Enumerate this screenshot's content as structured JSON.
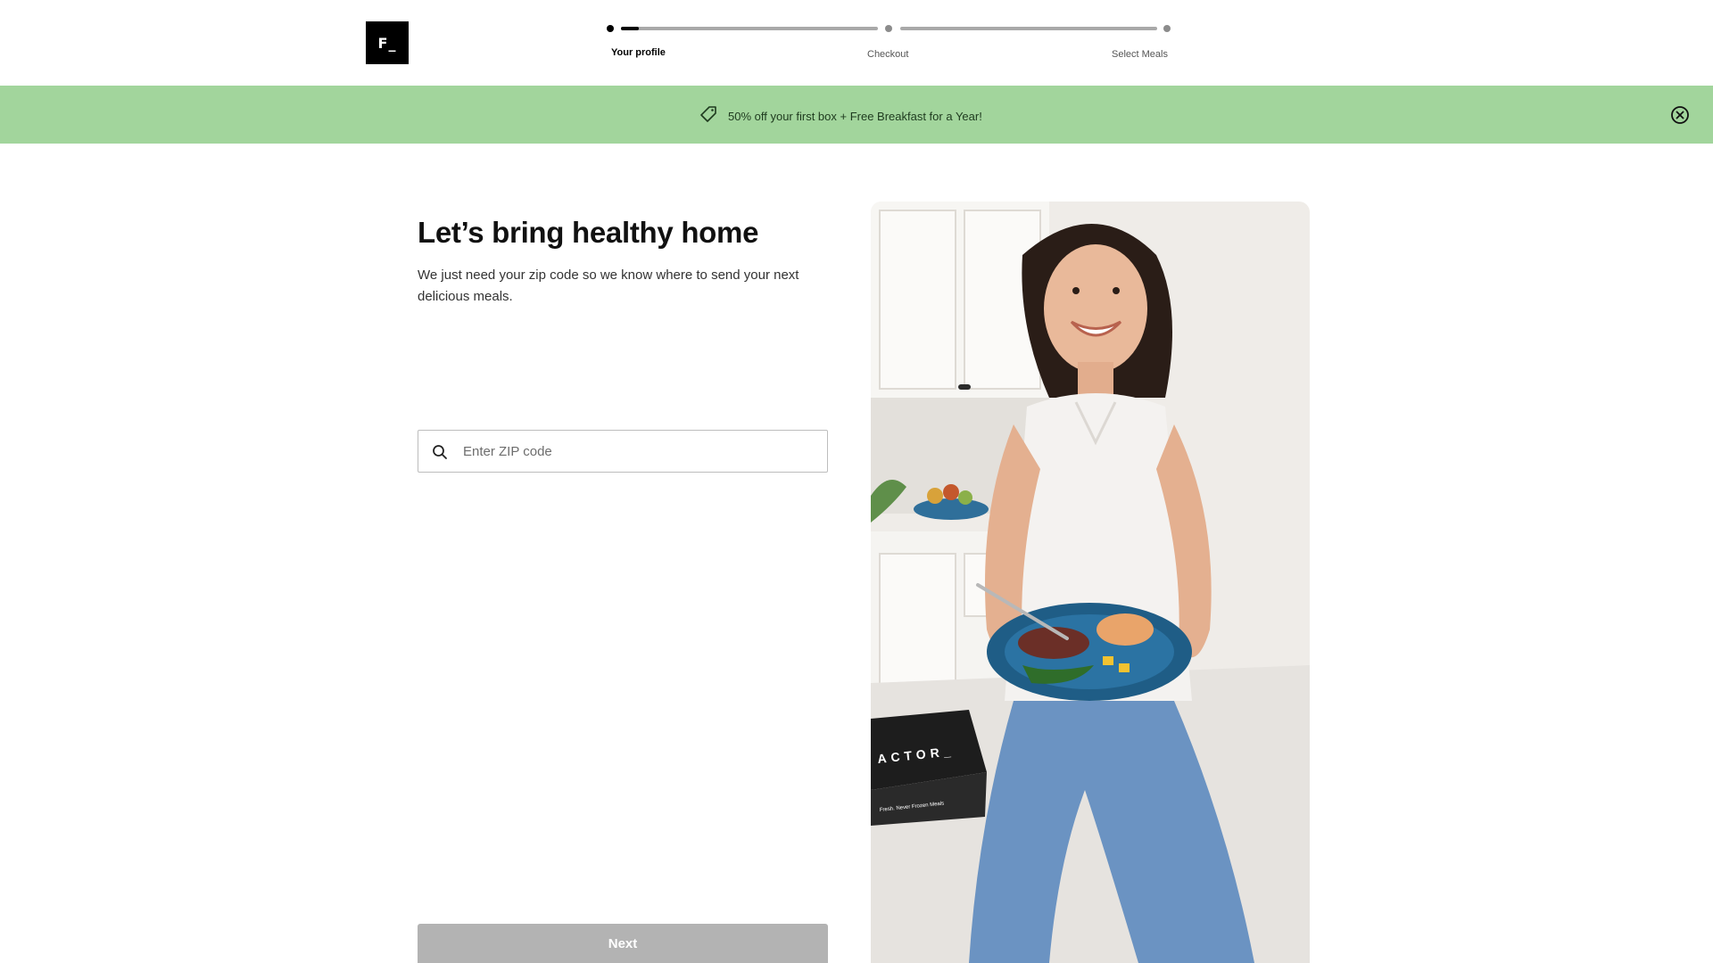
{
  "header": {
    "logo_text": "F_",
    "steps": [
      {
        "label": "Your profile",
        "active": true
      },
      {
        "label": "Checkout",
        "active": false
      },
      {
        "label": "Select Meals",
        "active": false
      }
    ],
    "progress": 0.07
  },
  "promo": {
    "icon": "tag-icon",
    "text": "50% off your first box + Free Breakfast for a Year!",
    "close_icon": "close-circle-icon",
    "background": "#a2d59c"
  },
  "main": {
    "headline": "Let’s bring healthy home",
    "subtext": "We just need your zip code so we know where to send your next delicious meals.",
    "zip": {
      "icon": "search-icon",
      "placeholder": "Enter ZIP code",
      "value": ""
    },
    "next_label": "Next"
  },
  "photo": {
    "box_brand_text": "ACTOR_",
    "box_tagline": "Fresh. Never Frozen Meals"
  }
}
